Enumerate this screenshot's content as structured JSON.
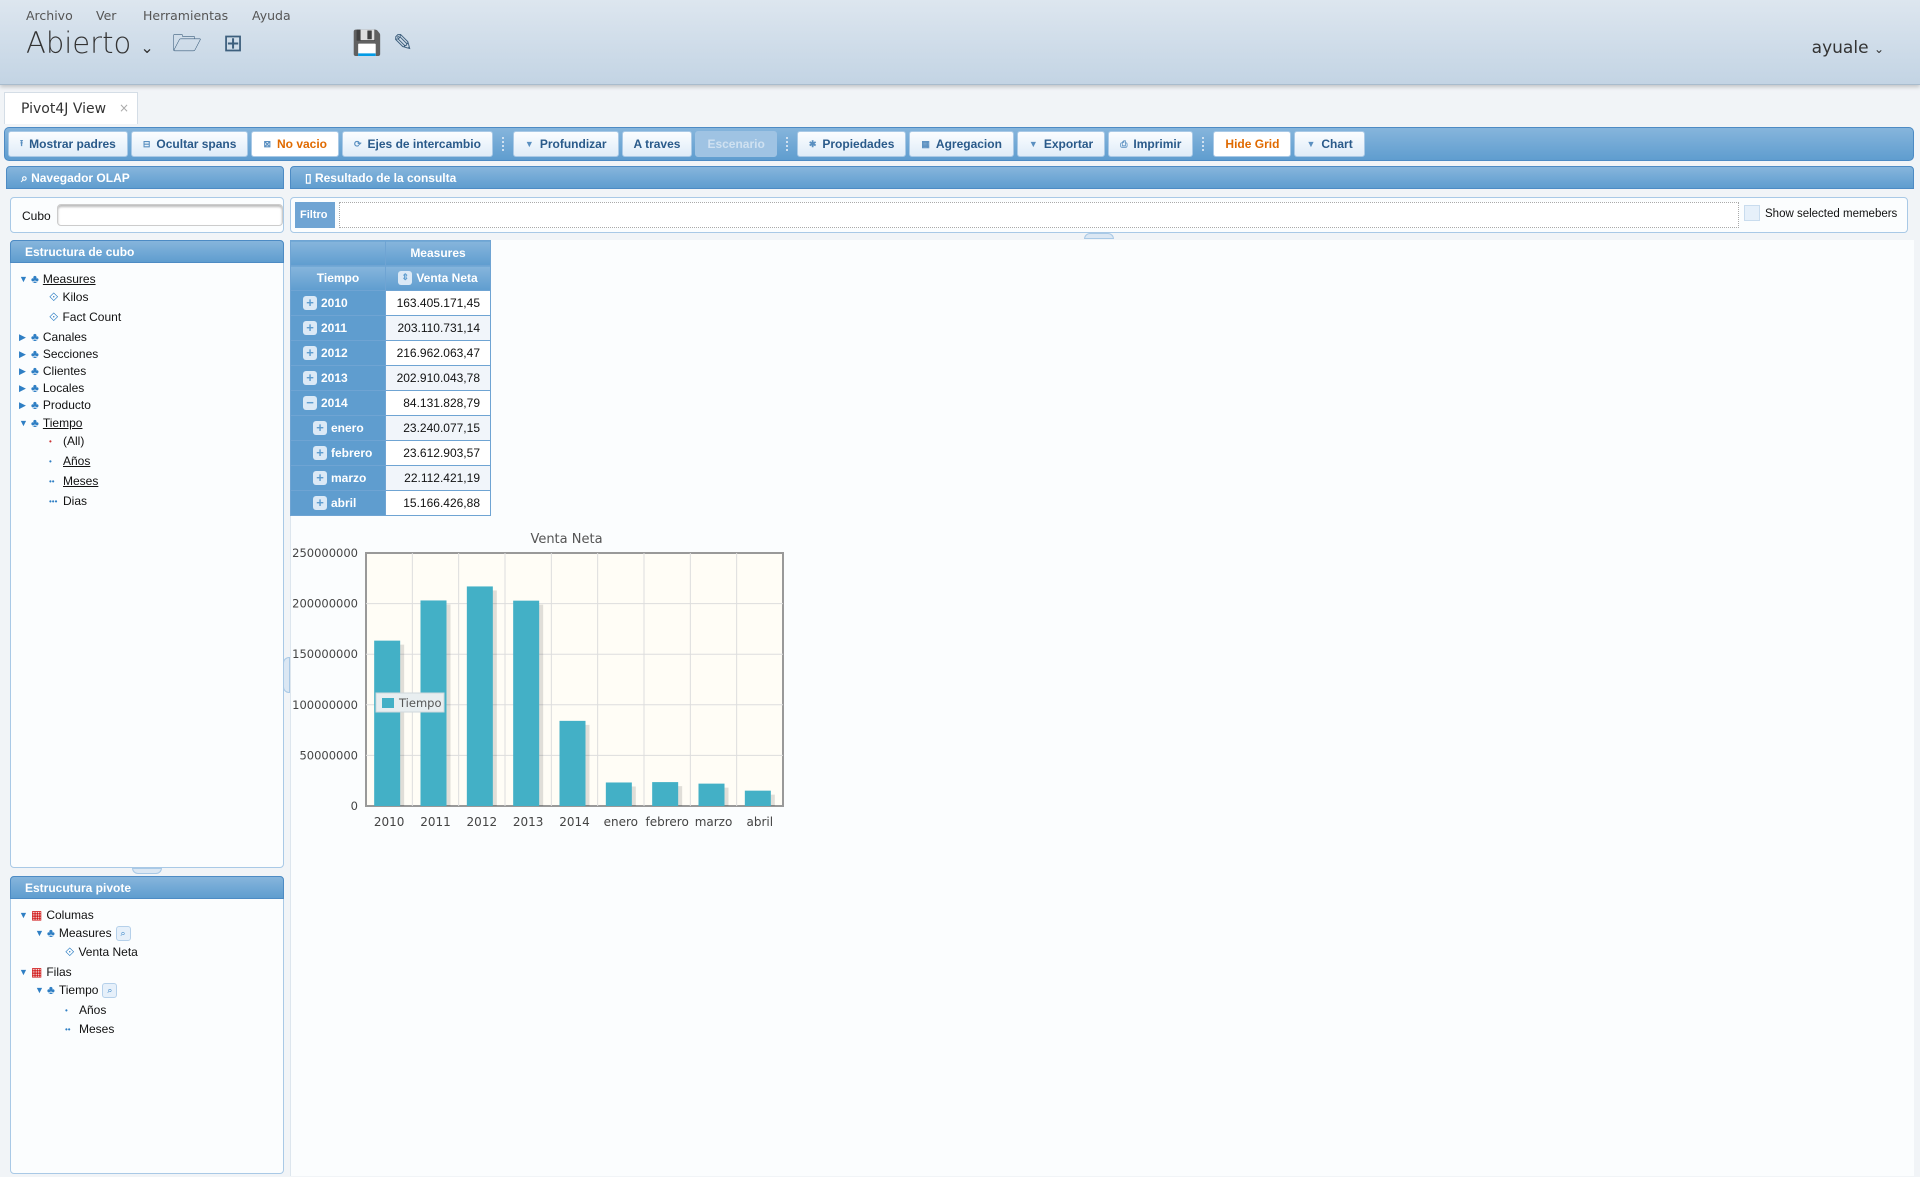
{
  "menu": [
    "Archivo",
    "Ver",
    "Herramientas",
    "Ayuda"
  ],
  "perspective": "Abierto",
  "user": "ayuale",
  "tab": {
    "label": "Pivot4J View",
    "close": "×"
  },
  "toolbar": [
    {
      "label": "Mostrar padres",
      "icon": "arrow-up-icon",
      "state": "normal"
    },
    {
      "label": "Ocultar spans",
      "icon": "minus-box-icon",
      "state": "normal"
    },
    {
      "label": "No vacio",
      "icon": "checkbox-icon",
      "state": "active"
    },
    {
      "label": "Ejes de intercambio",
      "icon": "swap-icon",
      "state": "normal"
    },
    {
      "label": "Profundizar",
      "icon": "dropdown-icon",
      "state": "normal"
    },
    {
      "label": "A traves",
      "icon": "",
      "state": "normal"
    },
    {
      "label": "Escenario",
      "icon": "",
      "state": "disabled"
    },
    {
      "label": "Propiedades",
      "icon": "gear-icon",
      "state": "normal"
    },
    {
      "label": "Agregacion",
      "icon": "grid-icon",
      "state": "normal"
    },
    {
      "label": "Exportar",
      "icon": "dropdown-icon",
      "state": "normal"
    },
    {
      "label": "Imprimir",
      "icon": "printer-icon",
      "state": "normal"
    },
    {
      "label": "Hide Grid",
      "icon": "",
      "state": "active"
    },
    {
      "label": "Chart",
      "icon": "dropdown-icon",
      "state": "normal"
    }
  ],
  "navigator": {
    "title": "Navegador OLAP",
    "cube_label": "Cubo",
    "cube_value": ""
  },
  "cube_structure": {
    "title": "Estructura de cubo",
    "items": [
      "Measures",
      "Kilos",
      "Fact Count",
      "Canales",
      "Secciones",
      "Clientes",
      "Locales",
      "Producto",
      "Tiempo",
      "(All)",
      "Años",
      "Meses",
      "Dias"
    ]
  },
  "pivot_structure": {
    "title": "Estrucutura pivote",
    "items": [
      "Columas",
      "Measures",
      "Venta Neta",
      "Filas",
      "Tiempo",
      "Años",
      "Meses"
    ]
  },
  "result": {
    "title": "Resultado de la consulta",
    "filter_label": "Filtro",
    "show_selected": "Show selected memebers"
  },
  "table": {
    "col_group": "Measures",
    "row_header": "Tiempo",
    "measure": "Venta Neta",
    "rows": [
      {
        "label": "2010",
        "value": "163.405.171,45",
        "expanded": false,
        "level": 0
      },
      {
        "label": "2011",
        "value": "203.110.731,14",
        "expanded": false,
        "level": 0
      },
      {
        "label": "2012",
        "value": "216.962.063,47",
        "expanded": false,
        "level": 0
      },
      {
        "label": "2013",
        "value": "202.910.043,78",
        "expanded": false,
        "level": 0
      },
      {
        "label": "2014",
        "value": "84.131.828,79",
        "expanded": true,
        "level": 0
      },
      {
        "label": "enero",
        "value": "23.240.077,15",
        "expanded": false,
        "level": 1
      },
      {
        "label": "febrero",
        "value": "23.612.903,57",
        "expanded": false,
        "level": 1
      },
      {
        "label": "marzo",
        "value": "22.112.421,19",
        "expanded": false,
        "level": 1
      },
      {
        "label": "abril",
        "value": "15.166.426,88",
        "expanded": false,
        "level": 1
      }
    ]
  },
  "chart_data": {
    "type": "bar",
    "title": "Venta Neta",
    "categories": [
      "2010",
      "2011",
      "2012",
      "2013",
      "2014",
      "enero",
      "febrero",
      "marzo",
      "abril"
    ],
    "series": [
      {
        "name": "Tiempo",
        "values": [
          163405171.45,
          203110731.14,
          216962063.47,
          202910043.78,
          84131828.79,
          23240077.15,
          23612903.57,
          22112421.19,
          15166426.88
        ]
      }
    ],
    "yticks": [
      "0",
      "50000000",
      "100000000",
      "150000000",
      "200000000",
      "250000000"
    ],
    "ylim": [
      0,
      250000000
    ],
    "grid": true,
    "legend": "left",
    "color": "#43b0c6"
  }
}
